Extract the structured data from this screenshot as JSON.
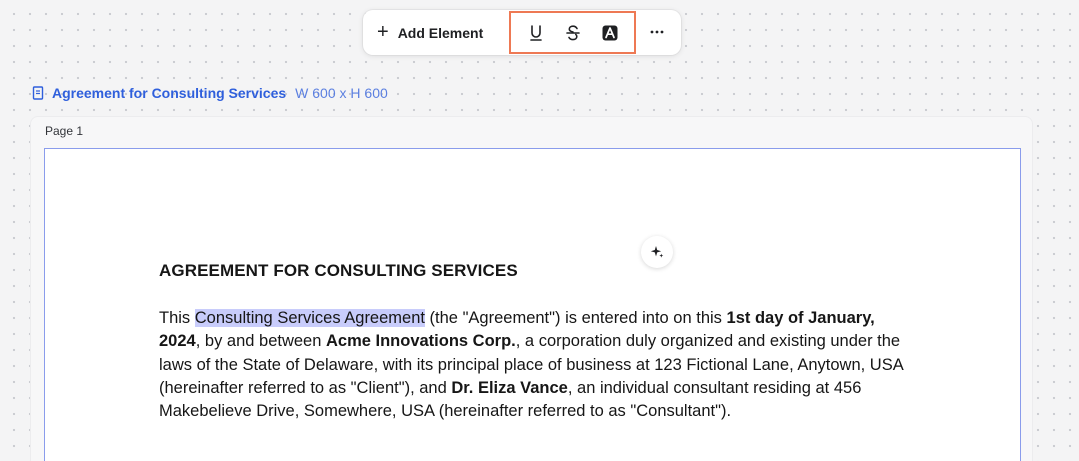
{
  "toolbar": {
    "add_element_icon": "plus-icon",
    "add_element_label": "Add Element",
    "format_tools": [
      "underline-icon",
      "strikethrough-icon",
      "text-highlight-icon"
    ],
    "more_icon": "ellipsis-icon",
    "highlight_color": "#ee7954"
  },
  "document": {
    "icon": "document-icon",
    "title": "Agreement for Consulting Services",
    "dimensions": "W 600 x H 600",
    "accent_color": "#2f5fdc"
  },
  "page": {
    "label": "Page 1",
    "ai_icon": "sparkle-icon",
    "heading": "AGREEMENT FOR CONSULTING SERVICES",
    "paragraph": {
      "t1": "This ",
      "selected": "Consulting Services Agreement",
      "t2": " (the \"Agreement\") is entered into on this ",
      "b1": "1st day of January, 2024",
      "t3": ", by and between ",
      "b2": "Acme Innovations Corp.",
      "t4": ", a corporation duly organized and existing under the laws of the State of Delaware, with its principal place of business at 123 Fictional Lane, Anytown, USA (hereinafter referred to as \"Client\"), and ",
      "b3": "Dr. Eliza Vance",
      "t5": ", an individual consultant residing at 456 Makebelieve Drive, Somewhere, USA (hereinafter referred to as \"Consultant\")."
    },
    "selection_color": "#c8ccfb"
  }
}
